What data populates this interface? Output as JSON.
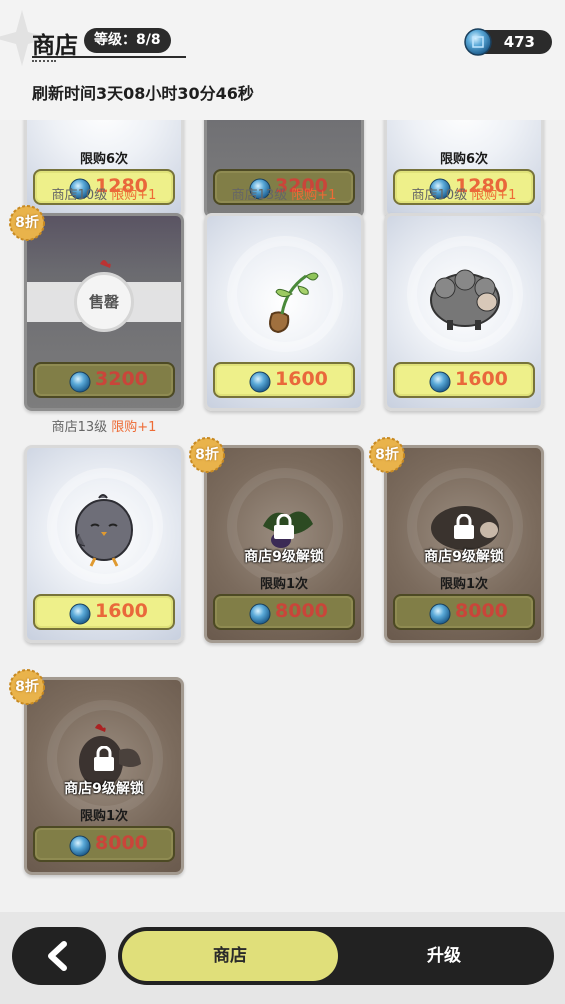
{
  "header": {
    "title": "商店",
    "level_badge": "等级：8/8",
    "currency_amount": "473",
    "refresh_text": "刷新时间3天08小时30分46秒"
  },
  "top_row": [
    {
      "limit_text": "限购6次",
      "price": "1280",
      "below_main": "商店10级",
      "below_plus": "限购+1"
    },
    {
      "limit_text": "",
      "price": "3200",
      "below_main": "商店13级",
      "below_plus": "限购+1"
    },
    {
      "limit_text": "限购6次",
      "price": "1280",
      "below_main": "商店10级",
      "below_plus": "限购+1"
    }
  ],
  "items": [
    {
      "name": "rooster",
      "price": "3200",
      "discount": "8折",
      "sold_out_label": "售罄",
      "below_main": "商店13级",
      "below_plus": "限购+1"
    },
    {
      "name": "seedling",
      "price": "1600"
    },
    {
      "name": "sheep",
      "price": "1600"
    },
    {
      "name": "chick",
      "price": "1600"
    },
    {
      "name": "eggplant-plant",
      "price": "8000",
      "discount": "8折",
      "lock_text": "商店9级解锁",
      "limit_text": "限购1次"
    },
    {
      "name": "black-sheep",
      "price": "8000",
      "discount": "8折",
      "lock_text": "商店9级解锁",
      "limit_text": "限购1次"
    },
    {
      "name": "rooster-locked",
      "price": "8000",
      "discount": "8折",
      "lock_text": "商店9级解锁",
      "limit_text": "限购1次"
    }
  ],
  "bottom_nav": {
    "tab_shop": "商店",
    "tab_upgrade": "升级"
  },
  "colors": {
    "price_text": "#e9683b",
    "plus_text": "#ee6b35",
    "button_yellow": "#eef08a",
    "dark_bar": "#222222"
  }
}
